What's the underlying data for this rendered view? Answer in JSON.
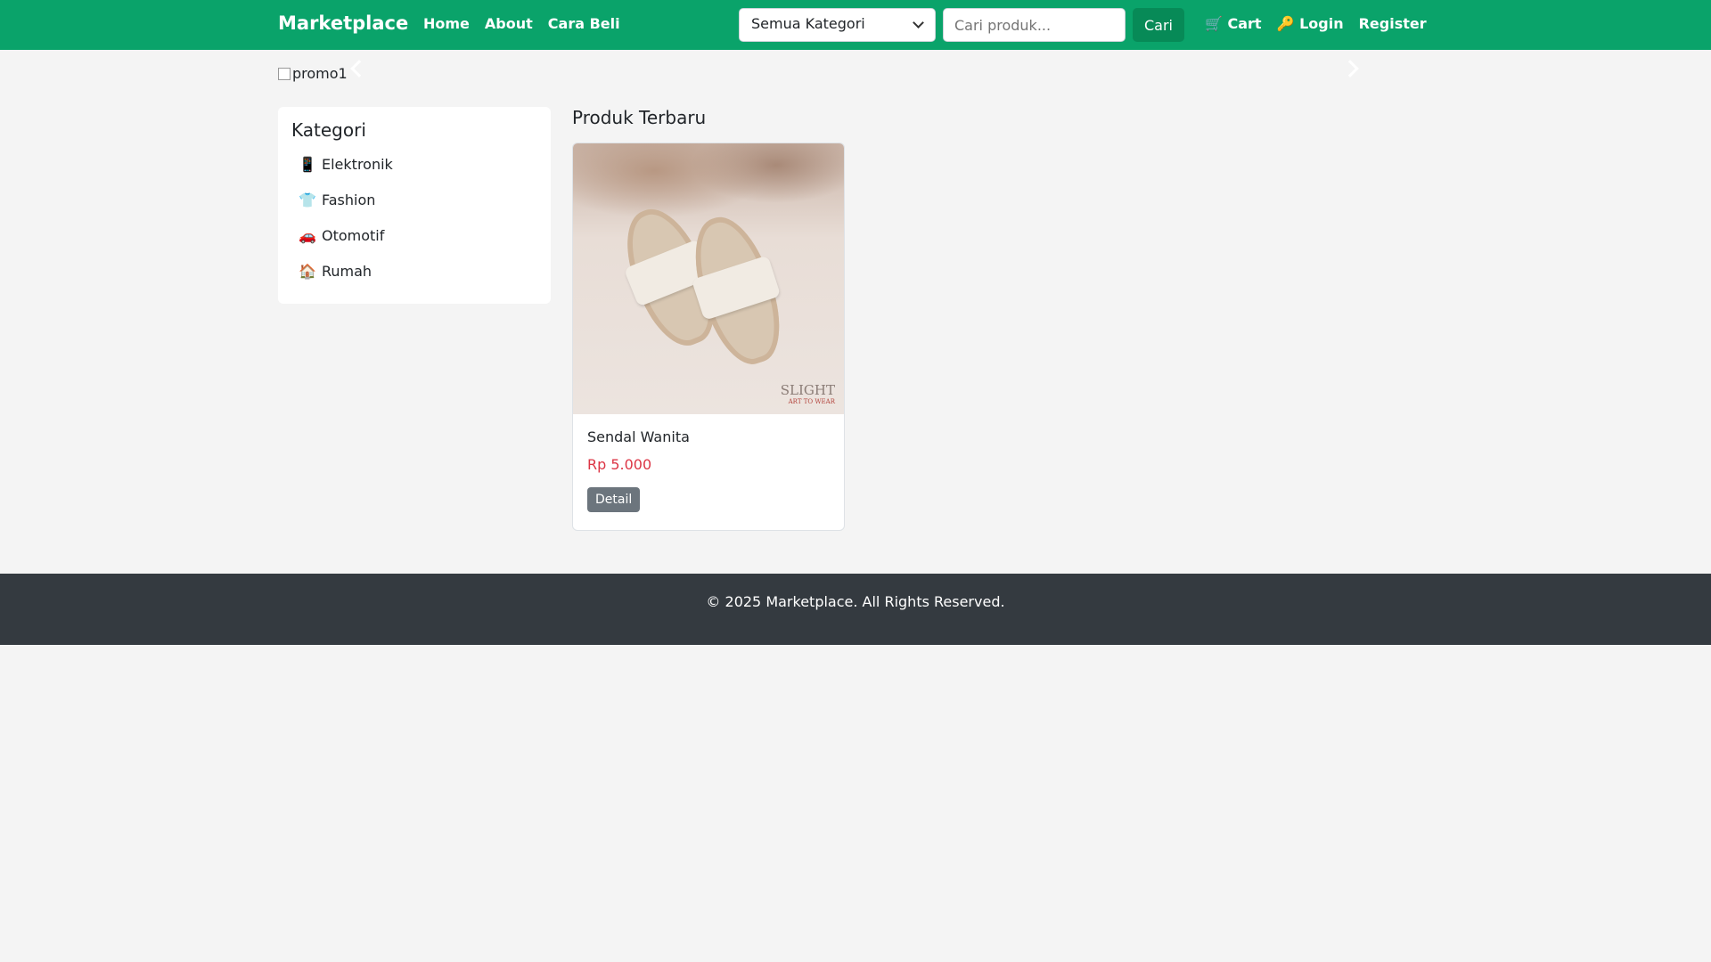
{
  "navbar": {
    "brand": "Marketplace",
    "links": [
      "Home",
      "About",
      "Cara Beli"
    ],
    "category_select": "Semua Kategori",
    "search_placeholder": "Cari produk...",
    "search_button": "Cari",
    "cart": "🛒 Cart",
    "login": "🔑 Login",
    "register": "Register",
    "color": "#0aa36a"
  },
  "promo": {
    "alt_text": "promo1"
  },
  "sidebar": {
    "title": "Kategori",
    "items": [
      {
        "icon": "📱",
        "label": "Elektronik"
      },
      {
        "icon": "👕",
        "label": "Fashion"
      },
      {
        "icon": "🚗",
        "label": "Otomotif"
      },
      {
        "icon": "🏠",
        "label": "Rumah"
      }
    ]
  },
  "products": {
    "title": "Produk Terbaru",
    "items": [
      {
        "name": "Sendal Wanita",
        "price": "Rp 5.000",
        "button": "Detail",
        "image_brand": "SLIGHT",
        "image_tagline": "ART TO WEAR"
      }
    ]
  },
  "footer": {
    "text": "© 2025 Marketplace. All Rights Reserved."
  }
}
